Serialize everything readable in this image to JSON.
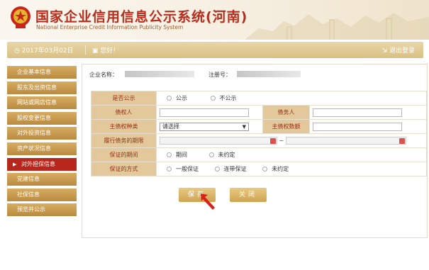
{
  "header": {
    "title_cn": "国家企业信用信息公示系统(河南)",
    "title_en": "National Enterprise Credit Information Publicity System"
  },
  "toolbar": {
    "date": "2017年03月02日",
    "greeting": "您好！",
    "logout": "退出登录"
  },
  "sidebar": {
    "items": [
      {
        "label": "企业基本信息"
      },
      {
        "label": "股东及出资信息"
      },
      {
        "label": "网站或网店信息"
      },
      {
        "label": "股权变更信息"
      },
      {
        "label": "对外投资信息"
      },
      {
        "label": "资产状况信息"
      },
      {
        "label": "对外担保信息",
        "active": true
      },
      {
        "label": "党建信息"
      },
      {
        "label": "社保信息"
      },
      {
        "label": "预览并公示"
      }
    ]
  },
  "info": {
    "company_label": "企业名称：",
    "reg_label": "注册号："
  },
  "form": {
    "public_label": "是否公示",
    "public_yes": "公示",
    "public_no": "不公示",
    "creditor_label": "债权人",
    "debtor_label": "债务人",
    "claim_type_label": "主债权种类",
    "claim_type_value": "请选择",
    "claim_amount_label": "主债权数额",
    "period_label": "履行债务的期限",
    "period_sep": "~",
    "guarantee_period_label": "保证的期间",
    "guarantee_period_opt1": "期间",
    "guarantee_period_opt2": "未约定",
    "guarantee_method_label": "保证的方式",
    "guarantee_method_opt1": "一般保证",
    "guarantee_method_opt2": "连带保证",
    "guarantee_method_opt3": "未约定"
  },
  "buttons": {
    "save": "保存",
    "close": "关闭"
  },
  "colors": {
    "brand_red": "#b62d1e",
    "gold": "#d6ad62",
    "label_bg": "#e2c89a"
  }
}
